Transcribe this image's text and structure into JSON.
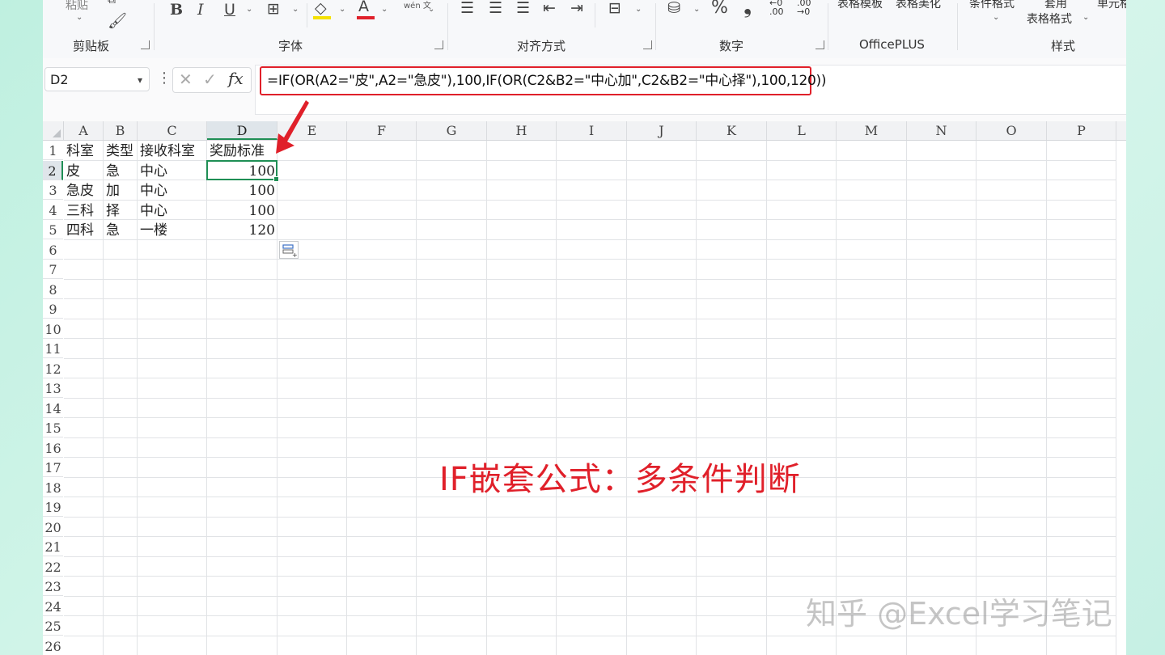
{
  "ribbon": {
    "clipboard": {
      "paste_label": "粘贴",
      "group_label": "剪贴板"
    },
    "font": {
      "group_label": "字体",
      "bold": "B",
      "italic": "I",
      "underline": "U",
      "font_color": "A",
      "phonetic": "wén 文"
    },
    "alignment": {
      "group_label": "对齐方式"
    },
    "number": {
      "group_label": "数字",
      "percent": "%",
      "comma": "❟"
    },
    "officeplus": {
      "group_label": "OfficePLUS",
      "table_template": "表格模板",
      "table_beautify": "表格美化"
    },
    "styles": {
      "group_label": "样式",
      "conditional_format": "条件格式",
      "format_as_table_1": "套用",
      "format_as_table_2": "表格格式",
      "cell_styles": "单元格"
    }
  },
  "formula_bar": {
    "name_box": "D2",
    "formula": "=IF(OR(A2=\"皮\",A2=\"急皮\"),100,IF(OR(C2&B2=\"中心加\",C2&B2=\"中心择\"),100,120))"
  },
  "sheet": {
    "columns": [
      "A",
      "B",
      "C",
      "D",
      "E",
      "F",
      "G",
      "H",
      "I",
      "J",
      "K",
      "L",
      "M",
      "N",
      "O",
      "P"
    ],
    "rows": [
      "1",
      "2",
      "3",
      "4",
      "5",
      "6",
      "7",
      "8",
      "9",
      "10",
      "11",
      "12",
      "13",
      "14",
      "15",
      "16",
      "17",
      "18",
      "19",
      "20",
      "21",
      "22",
      "23",
      "24",
      "25",
      "26"
    ],
    "data": [
      [
        "科室",
        "类型",
        "接收科室",
        "奖励标准"
      ],
      [
        "皮",
        "急",
        "中心",
        "100"
      ],
      [
        "急皮",
        "加",
        "中心",
        "100"
      ],
      [
        "三科",
        "择",
        "中心",
        "100"
      ],
      [
        "四科",
        "急",
        "一楼",
        "120"
      ]
    ],
    "active_cell": "D2"
  },
  "overlay": {
    "caption": "IF嵌套公式：多条件判断",
    "watermark": "知乎 @Excel学习笔记",
    "accent_color": "#e0202a",
    "selection_color": "#1f8f55"
  }
}
